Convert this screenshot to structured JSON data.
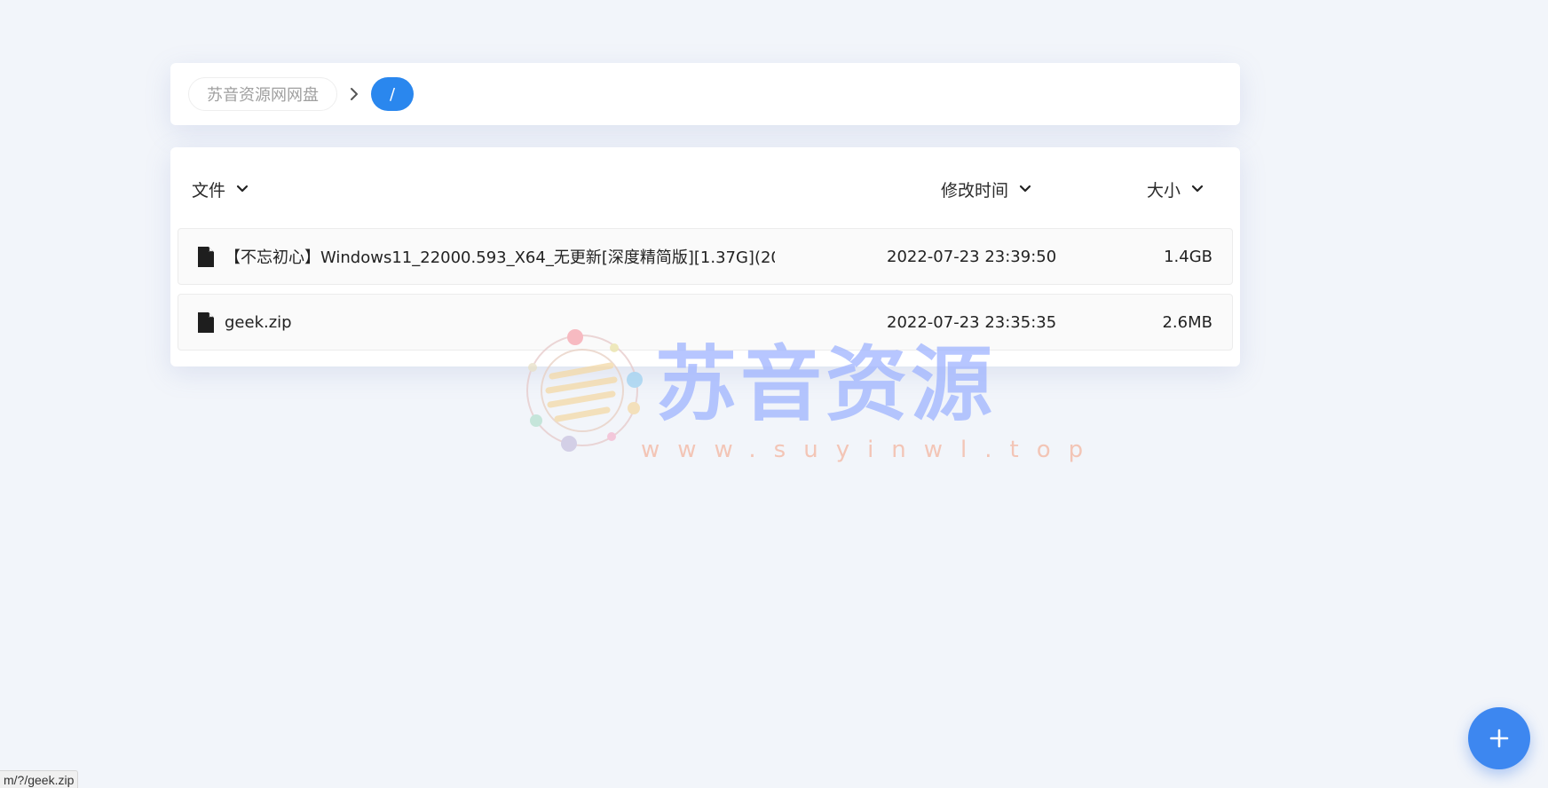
{
  "breadcrumb": {
    "root_label": "苏音资源网网盘",
    "current_label": "/"
  },
  "list": {
    "columns": {
      "name": "文件",
      "modified": "修改时间",
      "size": "大小"
    },
    "rows": [
      {
        "icon": "file-icon",
        "name": "【不忘初心】Windows11_22000.593_X64_无更新[深度精简版][1.37G](20...",
        "modified": "2022-07-23 23:39:50",
        "size": "1.4GB"
      },
      {
        "icon": "file-icon",
        "name": "geek.zip",
        "modified": "2022-07-23 23:35:35",
        "size": "2.6MB"
      }
    ]
  },
  "watermark": {
    "title": "苏音资源",
    "url": "www.suyinwl.top"
  },
  "fab": {
    "icon": "plus-icon"
  },
  "status_bar": {
    "link_preview": "m/?/geek.zip"
  },
  "colors": {
    "accent": "#2a87ee",
    "background": "#f2f5fa",
    "fab": "#3d87f0"
  }
}
